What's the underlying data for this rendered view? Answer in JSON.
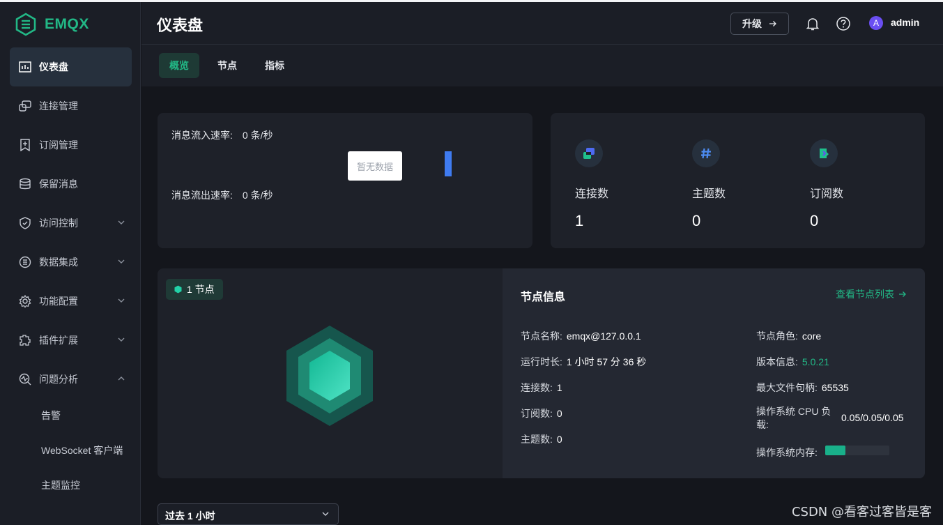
{
  "brand": {
    "name": "EMQX",
    "color": "#22b886"
  },
  "sidebar": {
    "items": [
      {
        "label": "仪表盘",
        "icon": "dashboard-icon",
        "active": true
      },
      {
        "label": "连接管理",
        "icon": "connections-icon"
      },
      {
        "label": "订阅管理",
        "icon": "subscriptions-icon"
      },
      {
        "label": "保留消息",
        "icon": "retained-icon"
      },
      {
        "label": "访问控制",
        "icon": "shield-icon",
        "expandable": true
      },
      {
        "label": "数据集成",
        "icon": "integration-icon",
        "expandable": true
      },
      {
        "label": "功能配置",
        "icon": "gear-icon",
        "expandable": true
      },
      {
        "label": "插件扩展",
        "icon": "plugin-icon",
        "expandable": true
      },
      {
        "label": "问题分析",
        "icon": "diagnose-icon",
        "expanded": true
      }
    ],
    "sub_items": [
      {
        "label": "告警"
      },
      {
        "label": "WebSocket 客户端"
      },
      {
        "label": "主题监控"
      }
    ]
  },
  "header": {
    "title": "仪表盘",
    "upgrade_label": "升级",
    "avatar_initial": "A",
    "username": "admin"
  },
  "tabs": [
    {
      "label": "概览",
      "active": true
    },
    {
      "label": "节点"
    },
    {
      "label": "指标"
    }
  ],
  "rates": {
    "in_label": "消息流入速率:",
    "in_value": "0 条/秒",
    "out_label": "消息流出速率:",
    "out_value": "0 条/秒",
    "no_data": "暂无数据"
  },
  "stats": [
    {
      "label": "连接数",
      "value": "1",
      "icon": "connection-icon"
    },
    {
      "label": "主题数",
      "value": "0",
      "icon": "hash-icon"
    },
    {
      "label": "订阅数",
      "value": "0",
      "icon": "subscription-icon"
    }
  ],
  "nodes": {
    "badge": "1 节点",
    "info_title": "节点信息",
    "view_list": "查看节点列表",
    "name_label": "节点名称:",
    "name_value": "emqx@127.0.0.1",
    "uptime_label": "运行时长:",
    "uptime_value": "1 小时 57 分 36 秒",
    "connections_label": "连接数:",
    "connections_value": "1",
    "subscriptions_label": "订阅数:",
    "subscriptions_value": "0",
    "topics_label": "主题数:",
    "topics_value": "0",
    "role_label": "节点角色:",
    "role_value": "core",
    "version_label": "版本信息:",
    "version_value": "5.0.21",
    "max_fds_label": "最大文件句柄:",
    "max_fds_value": "65535",
    "cpu_label": "操作系统 CPU 负载:",
    "cpu_value": "0.05/0.05/0.05",
    "memory_label": "操作系统内存:",
    "memory_fraction": 0.31
  },
  "time_range": {
    "selected": "过去 1 小时"
  },
  "watermark": "CSDN @看客过客皆是客"
}
